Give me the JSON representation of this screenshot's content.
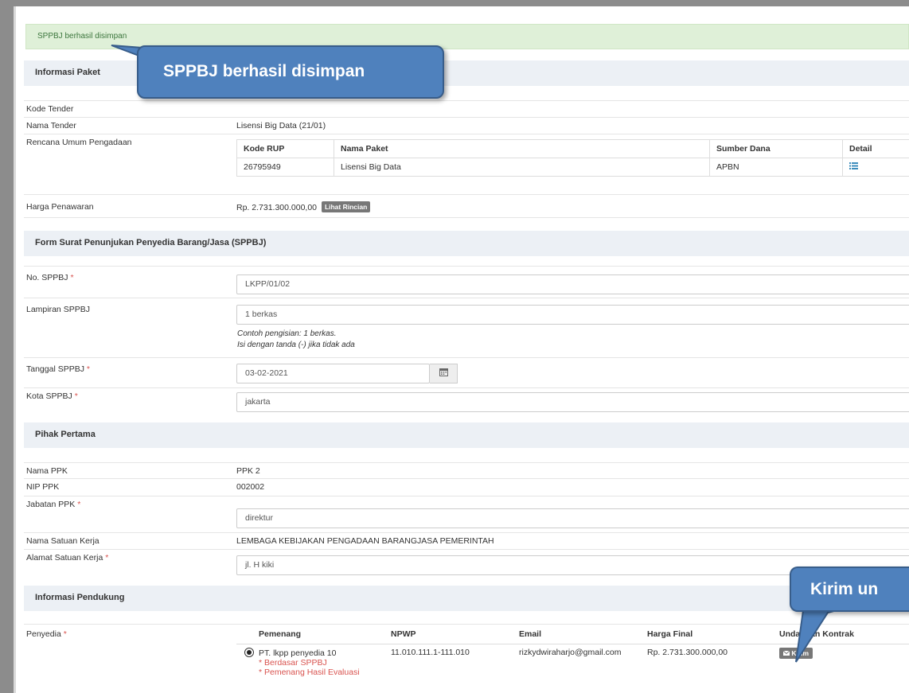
{
  "alert": {
    "text": "SPPBJ berhasil disimpan"
  },
  "callouts": {
    "top": "SPPBJ berhasil disimpan",
    "bottom": "Kirim un"
  },
  "informasi_paket": {
    "title": "Informasi Paket",
    "kode_tender_label": "Kode Tender",
    "nama_tender_label": "Nama Tender",
    "nama_tender_value": "Lisensi Big Data (21/01)",
    "rup_label": "Rencana Umum Pengadaan",
    "rup_table": {
      "headers": [
        "Kode RUP",
        "Nama Paket",
        "Sumber Dana",
        "Detail"
      ],
      "rows": [
        [
          "26795949",
          "Lisensi Big Data",
          "APBN"
        ]
      ]
    },
    "harga_label": "Harga Penawaran",
    "harga_value": "Rp. 2.731.300.000,00",
    "rincian_button": "Lihat Rincian"
  },
  "form_sppbj": {
    "title": "Form Surat Penunjukan Penyedia Barang/Jasa (SPPBJ)",
    "no_label": "No. SPPBJ",
    "no_value": "LKPP/01/02",
    "lampiran_label": "Lampiran SPPBJ",
    "lampiran_value": "1 berkas",
    "hint1": "Contoh pengisian: 1 berkas.",
    "hint2": "Isi dengan tanda (-) jika tidak ada",
    "tanggal_label": "Tanggal SPPBJ",
    "tanggal_value": "03-02-2021",
    "kota_label": "Kota SPPBJ",
    "kota_value": "jakarta"
  },
  "pihak_pertama": {
    "title": "Pihak Pertama",
    "nama_ppk_label": "Nama PPK",
    "nama_ppk_value": "PPK 2",
    "nip_label": "NIP PPK",
    "nip_value": "002002",
    "jabatan_label": "Jabatan PPK",
    "jabatan_value": "direktur",
    "satuan_label": "Nama Satuan Kerja",
    "satuan_value": "LEMBAGA KEBIJAKAN PENGADAAN BARANGJASA PEMERINTAH",
    "alamat_label": "Alamat Satuan Kerja",
    "alamat_value": "jl. H kiki"
  },
  "informasi_pendukung": {
    "title": "Informasi Pendukung",
    "penyedia_label": "Penyedia",
    "headers": [
      "Pemenang",
      "NPWP",
      "Email",
      "Harga Final",
      "Undangan Kontrak"
    ],
    "pemenang_name": "PT. lkpp penyedia 10",
    "note1": "* Berdasar SPPBJ",
    "note2": "* Pemenang Hasil Evaluasi",
    "npwp": "11.010.111.1-111.010",
    "email": "rizkydwiraharjo@gmail.com",
    "harga_final": "Rp. 2.731.300.000,00",
    "kirim_label": "Kirim"
  },
  "required_mark": "*"
}
